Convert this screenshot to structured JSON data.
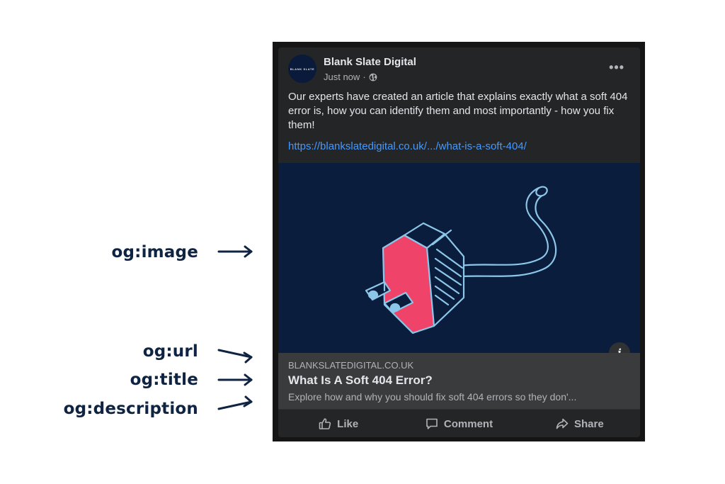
{
  "annotations": {
    "image": "og:image",
    "url": "og:url",
    "title": "og:title",
    "description": "og:description"
  },
  "post": {
    "page_name": "Blank Slate Digital",
    "avatar_text": "BLANK SLATE",
    "timestamp": "Just now",
    "separator": "·",
    "privacy_icon": "globe-icon",
    "more_icon": "more-horizontal-icon",
    "more_label": "•••",
    "text": "Our experts have created an article that explains exactly what a soft 404 error is, how you can identify them and most importantly - how you fix them!",
    "link": "https://blankslatedigital.co.uk/.../what-is-a-soft-404/",
    "image_icon": "unplugged-plug-illustration",
    "info_label": "i"
  },
  "preview": {
    "url": "BLANKSLATEDIGITAL.CO.UK",
    "title": "What Is A Soft 404 Error?",
    "description": "Explore how and why you should fix soft 404 errors so they don'..."
  },
  "actions": [
    {
      "label": "Like",
      "icon": "thumbs-up-icon"
    },
    {
      "label": "Comment",
      "icon": "comment-bubble-icon"
    },
    {
      "label": "Share",
      "icon": "share-arrow-icon"
    }
  ],
  "colors": {
    "card_bg": "#242526",
    "image_bg": "#0a1d3d",
    "plug_pink": "#f0436a",
    "outline_blue": "#8cc6e8",
    "link_blue": "#4599ff",
    "annotation_navy": "#0f2342"
  }
}
